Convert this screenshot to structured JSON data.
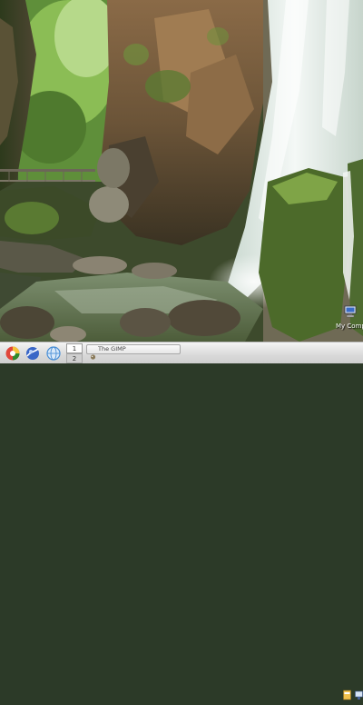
{
  "desktop": {
    "wallpaper": "waterfall-gorge-photo",
    "icons": [
      {
        "label": "My Computer",
        "icon": "computer-icon"
      }
    ]
  },
  "taskbar": {
    "launchers": [
      {
        "icon": "menu-icon",
        "color": "#2e8a2e"
      },
      {
        "icon": "browser-icon",
        "color": "#3a67c7"
      },
      {
        "icon": "globe-icon",
        "color": "#4a8fd6"
      }
    ],
    "workspaces": [
      "1",
      "2"
    ],
    "tasks": [
      {
        "label": "The GIMP",
        "icon": "gimp-icon"
      }
    ],
    "tray": [
      "file-manager-icon",
      "network-icon"
    ]
  },
  "colors": {
    "taskbar_bg": "#d9d9d9",
    "water": "#eef4f0",
    "foliage": "#3f6a28",
    "rock": "#6b5a40"
  }
}
